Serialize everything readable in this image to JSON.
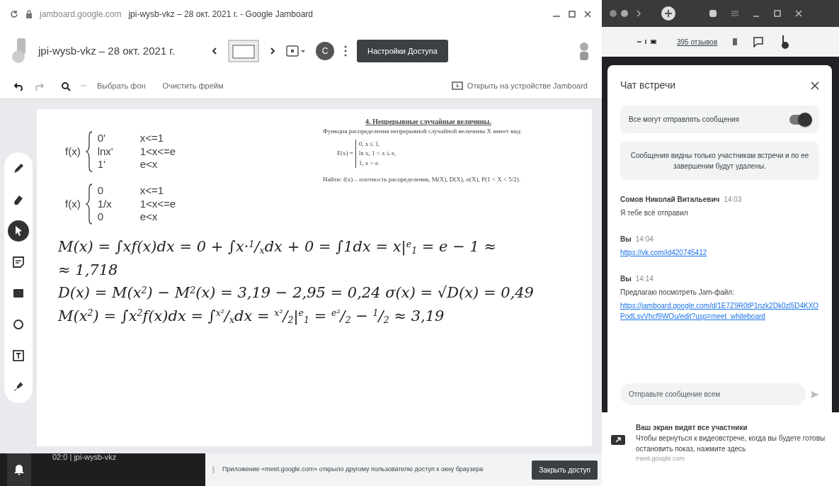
{
  "browser": {
    "site": "jamboard.google.com",
    "title": "jpi-wysb-vkz – 28 окт. 2021 г. - Google Jamboard"
  },
  "header": {
    "file_title": "jpi-wysb-vkz – 28 окт. 2021 г.",
    "avatar_initial": "C",
    "share_button": "Настройки Доступа"
  },
  "toolbar": {
    "background_button": "Выбрать фон",
    "clear_button": "Очистить фрейм",
    "open_device_link": "Открыть на устройстве Jamboard"
  },
  "tools": [
    {
      "kind": "pen",
      "selected": false
    },
    {
      "kind": "eraser",
      "selected": false
    },
    {
      "kind": "select",
      "selected": true
    },
    {
      "kind": "note",
      "selected": false
    },
    {
      "kind": "image",
      "selected": false
    },
    {
      "kind": "shape",
      "selected": false
    },
    {
      "kind": "textbox",
      "selected": false
    },
    {
      "kind": "laser",
      "selected": false
    }
  ],
  "frame": {
    "piecewise": [
      {
        "lhs": "f(x)",
        "rows": [
          [
            "0'",
            "x<=1"
          ],
          [
            "lnx'",
            "1<x<=e"
          ],
          [
            "1'",
            "e<x"
          ]
        ]
      },
      {
        "lhs": "f(x)",
        "rows": [
          [
            "0",
            "x<=1"
          ],
          [
            "1/x",
            "1<x<=e"
          ],
          [
            "0",
            "e<x"
          ]
        ]
      }
    ],
    "document": {
      "heading": "4. Непрерывные случайные величины.",
      "text": "Функция распределения непрерывной случайной величины X имеет вид:",
      "lhs": "F(x) =",
      "rows": [
        "0,   x ≤ 1,",
        "ln x,   1 < x ≤ e,",
        "1,   x > e."
      ],
      "task": "Найти:  f(x) – плотность распределения,  M(X),  D(X),  σ(X),  P(1 < X < 5/2)."
    },
    "handwriting": [
      "M(x) = ∫xf(x)dx = 0 + ∫x·$^{1}$/$_{x}$dx + 0 = ∫1dx = x|$^{e}$$_{1}$ = e − 1 ≈",
      "≈ 1,718",
      "D(x) = M(x$^{2}$) − M$^{2}$(x) = 3,19 − 2,95 = 0,24   σ(x) = √D(x) = 0,49",
      "M(x$^{2}$) = ∫x$^{2}$f(x)dx = ∫$^{x²}$/$_{x}$dx = $^{x²}$/$_{2}$|$^{e}$$_{1}$ = $^{e²}$/$_{2}$ − $^{1}$/$_{2}$ ≈ 3,19"
    ]
  },
  "meet_bar": {
    "reviews": "395 отзывов"
  },
  "chat": {
    "title": "Чат встречи",
    "permission": {
      "label": "Все могут отправлять сообщения",
      "on": true
    },
    "notice": "Сообщения видны только участникам встречи и по ее завершении будут удалены.",
    "messages": [
      {
        "sender": "Сомов Николай Витальевич",
        "time": "14:03",
        "text": "Я тебе всё отправил"
      },
      {
        "sender": "Вы",
        "time": "14:04",
        "link": "https://vk.com/id420745412"
      },
      {
        "sender": "Вы",
        "time": "14:14",
        "text": "Предлагаю посмотреть Jam-файл:",
        "link": "https://jamboard.google.com/d/1E7Z9R0tP1nzk2Dk0zl5D4KXOPodLsvVhcf9WOu/edit?usp=meet_whiteboard"
      }
    ],
    "input_placeholder": "Отправьте сообщение всем"
  },
  "notification": {
    "title": "Ваш экран видят все участники",
    "body": "Чтобы вернуться к видеовстрече, когда вы будете готовы остановить показ, нажмите здесь",
    "source": "meet.google.com"
  },
  "taskbar": {
    "label": "02:0 | jpi-wysb-vkz"
  },
  "share_bar": {
    "text": "Приложение «meet.google.com» открыло другому пользователю доступ к окну браузера",
    "button": "Закрыть доступ"
  }
}
